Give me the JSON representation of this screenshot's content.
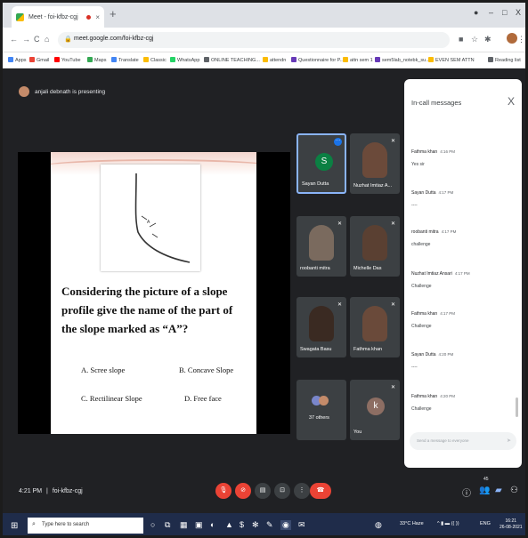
{
  "browser": {
    "tab_title": "Meet - foi-kfbz-cgj",
    "tab_close": "×",
    "new_tab": "+",
    "url": "meet.google.com/foi-kfbz-cgj",
    "win_min": "–",
    "win_max": "□",
    "win_close": "X"
  },
  "bookmarks": [
    {
      "label": "Apps",
      "color": "#4285f4"
    },
    {
      "label": "Gmail",
      "color": "#ea4335"
    },
    {
      "label": "YouTube",
      "color": "#ff0000"
    },
    {
      "label": "Maps",
      "color": "#34a853"
    },
    {
      "label": "Translate",
      "color": "#4285f4"
    },
    {
      "label": "Classic",
      "color": "#fbbc04"
    },
    {
      "label": "WhatsApp",
      "color": "#25d366"
    },
    {
      "label": "ONLINE TEACHING...",
      "color": "#5f6368"
    },
    {
      "label": "attendn",
      "color": "#fbbc04"
    },
    {
      "label": "Questionnaire for P...",
      "color": "#673ab7"
    },
    {
      "label": "attn sem 1",
      "color": "#fbbc04"
    },
    {
      "label": "sem5lab_notebk_su...",
      "color": "#673ab7"
    },
    {
      "label": "EVEN SEM ATTN",
      "color": "#fbbc04"
    },
    {
      "label": "Reading list",
      "color": "#5f6368"
    }
  ],
  "meet": {
    "presenter_text": "anjali debnath is presenting",
    "time": "4:21 PM",
    "separator": "|",
    "meeting_code": "foi-kfbz-cgj"
  },
  "slide": {
    "question": "Considering the picture of a slope profile give the name of the part of the slope marked as “A”?",
    "diagram_label": "A",
    "options": {
      "a": "A. Scree slope",
      "b": "B. Concave Slope",
      "c": "C. Rectilinear  Slope",
      "d": "D. Free face"
    }
  },
  "participants": [
    {
      "name": "Sayan Dutta",
      "initial": "S",
      "avatar_color": "#0b8043"
    },
    {
      "name": "Nuzhat Imtiaz A...",
      "face_color": "#6b4a3a"
    },
    {
      "name": "roobanti mitra",
      "face_color": "#7a6a5e"
    },
    {
      "name": "Michelle Das",
      "face_color": "#5a4032"
    },
    {
      "name": "Swagata Basu",
      "face_color": "#3a2a22"
    },
    {
      "name": "Fathma khan",
      "face_color": "#6a4a3a"
    },
    {
      "name": "37 others"
    },
    {
      "name": "You",
      "initial": "k",
      "avatar_color": "#8d6e63"
    }
  ],
  "chat": {
    "title": "In-call messages",
    "close": "X",
    "messages": [
      {
        "sender": "Fathma khan",
        "time": "4:16 PM",
        "text": "Yes sir"
      },
      {
        "sender": "Sayan Dutta",
        "time": "4:17 PM",
        "text": "----"
      },
      {
        "sender": "roobanti mitra",
        "time": "4:17 PM",
        "text": "challenge"
      },
      {
        "sender": "Nuzhat Imtiaz Ansari",
        "time": "4:17 PM",
        "text": "Challenge"
      },
      {
        "sender": "Fathma khan",
        "time": "4:17 PM",
        "text": "Challenge"
      },
      {
        "sender": "Sayan Dutta",
        "time": "4:20 PM",
        "text": "----"
      },
      {
        "sender": "Fathma khan",
        "time": "4:20 PM",
        "text": "Challenge"
      }
    ],
    "input_placeholder": "Send a message to everyone"
  },
  "controls": {
    "people_count": "45"
  },
  "taskbar": {
    "search_placeholder": "Type here to search",
    "weather": "33°C  Haze",
    "lang": "ENG",
    "time": "16:21",
    "date": "26-08-2021"
  },
  "colors": {
    "meet_bg": "#202124",
    "end_call_red": "#ea4335",
    "accent_blue": "#8ab4f8",
    "taskbar": "#1f2c4a"
  }
}
